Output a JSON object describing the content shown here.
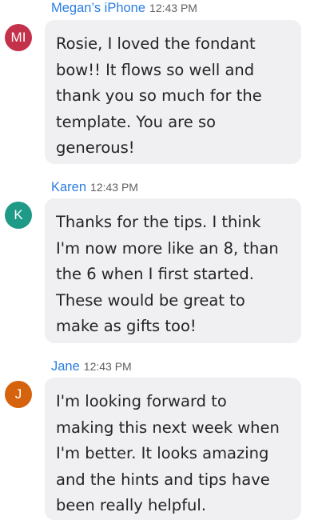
{
  "colors": {
    "sender_name": "#2a7de1",
    "bubble_bg": "#f0f0f3",
    "text": "#242424",
    "timestamp": "#616161"
  },
  "messages": [
    {
      "avatar_initials": "MI",
      "avatar_color": "#c4314b",
      "sender": "Megan’s iPhone",
      "time": "12:43 PM",
      "lines": [
        "Rosie, I loved the fondant",
        "bow!! It flows so well and",
        "thank you so much for the",
        "template. You are so",
        "generous!"
      ]
    },
    {
      "avatar_initials": "K",
      "avatar_color": "#1e9a86",
      "sender": "Karen",
      "time": "12:43 PM",
      "lines": [
        "Thanks for the tips. I think",
        "I'm now more like an 8, than",
        "the 6 when I first started.",
        "These would be great to",
        "make as gifts too!"
      ]
    },
    {
      "avatar_initials": "J",
      "avatar_color": "#d5620c",
      "sender": "Jane",
      "time": "12:43 PM",
      "lines": [
        "I'm looking forward to",
        "making this next week when",
        "I'm better. It looks amazing",
        "and the hints and tips have",
        "been really helpful."
      ]
    }
  ]
}
